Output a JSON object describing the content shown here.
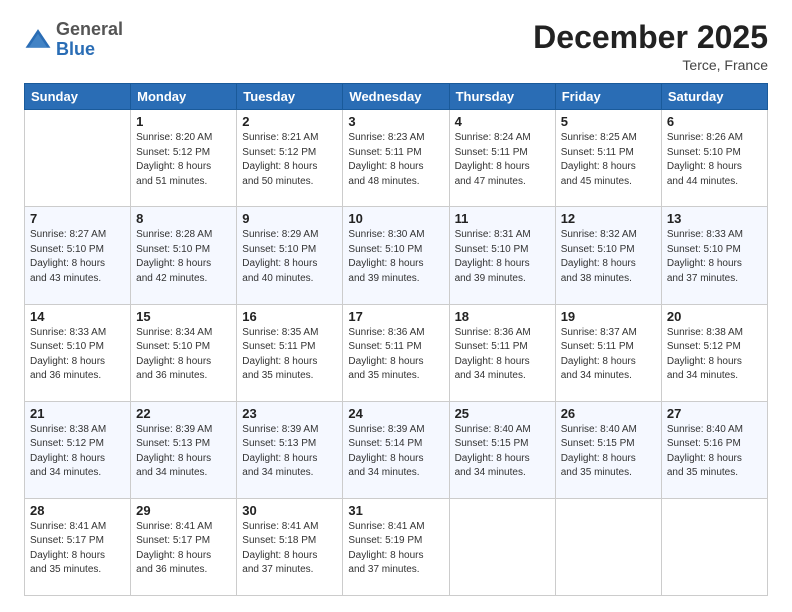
{
  "header": {
    "logo_general": "General",
    "logo_blue": "Blue",
    "month_title": "December 2025",
    "location": "Terce, France"
  },
  "weekdays": [
    "Sunday",
    "Monday",
    "Tuesday",
    "Wednesday",
    "Thursday",
    "Friday",
    "Saturday"
  ],
  "weeks": [
    [
      {
        "day": "",
        "info": ""
      },
      {
        "day": "1",
        "info": "Sunrise: 8:20 AM\nSunset: 5:12 PM\nDaylight: 8 hours\nand 51 minutes."
      },
      {
        "day": "2",
        "info": "Sunrise: 8:21 AM\nSunset: 5:12 PM\nDaylight: 8 hours\nand 50 minutes."
      },
      {
        "day": "3",
        "info": "Sunrise: 8:23 AM\nSunset: 5:11 PM\nDaylight: 8 hours\nand 48 minutes."
      },
      {
        "day": "4",
        "info": "Sunrise: 8:24 AM\nSunset: 5:11 PM\nDaylight: 8 hours\nand 47 minutes."
      },
      {
        "day": "5",
        "info": "Sunrise: 8:25 AM\nSunset: 5:11 PM\nDaylight: 8 hours\nand 45 minutes."
      },
      {
        "day": "6",
        "info": "Sunrise: 8:26 AM\nSunset: 5:10 PM\nDaylight: 8 hours\nand 44 minutes."
      }
    ],
    [
      {
        "day": "7",
        "info": "Sunrise: 8:27 AM\nSunset: 5:10 PM\nDaylight: 8 hours\nand 43 minutes."
      },
      {
        "day": "8",
        "info": "Sunrise: 8:28 AM\nSunset: 5:10 PM\nDaylight: 8 hours\nand 42 minutes."
      },
      {
        "day": "9",
        "info": "Sunrise: 8:29 AM\nSunset: 5:10 PM\nDaylight: 8 hours\nand 40 minutes."
      },
      {
        "day": "10",
        "info": "Sunrise: 8:30 AM\nSunset: 5:10 PM\nDaylight: 8 hours\nand 39 minutes."
      },
      {
        "day": "11",
        "info": "Sunrise: 8:31 AM\nSunset: 5:10 PM\nDaylight: 8 hours\nand 39 minutes."
      },
      {
        "day": "12",
        "info": "Sunrise: 8:32 AM\nSunset: 5:10 PM\nDaylight: 8 hours\nand 38 minutes."
      },
      {
        "day": "13",
        "info": "Sunrise: 8:33 AM\nSunset: 5:10 PM\nDaylight: 8 hours\nand 37 minutes."
      }
    ],
    [
      {
        "day": "14",
        "info": "Sunrise: 8:33 AM\nSunset: 5:10 PM\nDaylight: 8 hours\nand 36 minutes."
      },
      {
        "day": "15",
        "info": "Sunrise: 8:34 AM\nSunset: 5:10 PM\nDaylight: 8 hours\nand 36 minutes."
      },
      {
        "day": "16",
        "info": "Sunrise: 8:35 AM\nSunset: 5:11 PM\nDaylight: 8 hours\nand 35 minutes."
      },
      {
        "day": "17",
        "info": "Sunrise: 8:36 AM\nSunset: 5:11 PM\nDaylight: 8 hours\nand 35 minutes."
      },
      {
        "day": "18",
        "info": "Sunrise: 8:36 AM\nSunset: 5:11 PM\nDaylight: 8 hours\nand 34 minutes."
      },
      {
        "day": "19",
        "info": "Sunrise: 8:37 AM\nSunset: 5:11 PM\nDaylight: 8 hours\nand 34 minutes."
      },
      {
        "day": "20",
        "info": "Sunrise: 8:38 AM\nSunset: 5:12 PM\nDaylight: 8 hours\nand 34 minutes."
      }
    ],
    [
      {
        "day": "21",
        "info": "Sunrise: 8:38 AM\nSunset: 5:12 PM\nDaylight: 8 hours\nand 34 minutes."
      },
      {
        "day": "22",
        "info": "Sunrise: 8:39 AM\nSunset: 5:13 PM\nDaylight: 8 hours\nand 34 minutes."
      },
      {
        "day": "23",
        "info": "Sunrise: 8:39 AM\nSunset: 5:13 PM\nDaylight: 8 hours\nand 34 minutes."
      },
      {
        "day": "24",
        "info": "Sunrise: 8:39 AM\nSunset: 5:14 PM\nDaylight: 8 hours\nand 34 minutes."
      },
      {
        "day": "25",
        "info": "Sunrise: 8:40 AM\nSunset: 5:15 PM\nDaylight: 8 hours\nand 34 minutes."
      },
      {
        "day": "26",
        "info": "Sunrise: 8:40 AM\nSunset: 5:15 PM\nDaylight: 8 hours\nand 35 minutes."
      },
      {
        "day": "27",
        "info": "Sunrise: 8:40 AM\nSunset: 5:16 PM\nDaylight: 8 hours\nand 35 minutes."
      }
    ],
    [
      {
        "day": "28",
        "info": "Sunrise: 8:41 AM\nSunset: 5:17 PM\nDaylight: 8 hours\nand 35 minutes."
      },
      {
        "day": "29",
        "info": "Sunrise: 8:41 AM\nSunset: 5:17 PM\nDaylight: 8 hours\nand 36 minutes."
      },
      {
        "day": "30",
        "info": "Sunrise: 8:41 AM\nSunset: 5:18 PM\nDaylight: 8 hours\nand 37 minutes."
      },
      {
        "day": "31",
        "info": "Sunrise: 8:41 AM\nSunset: 5:19 PM\nDaylight: 8 hours\nand 37 minutes."
      },
      {
        "day": "",
        "info": ""
      },
      {
        "day": "",
        "info": ""
      },
      {
        "day": "",
        "info": ""
      }
    ]
  ]
}
